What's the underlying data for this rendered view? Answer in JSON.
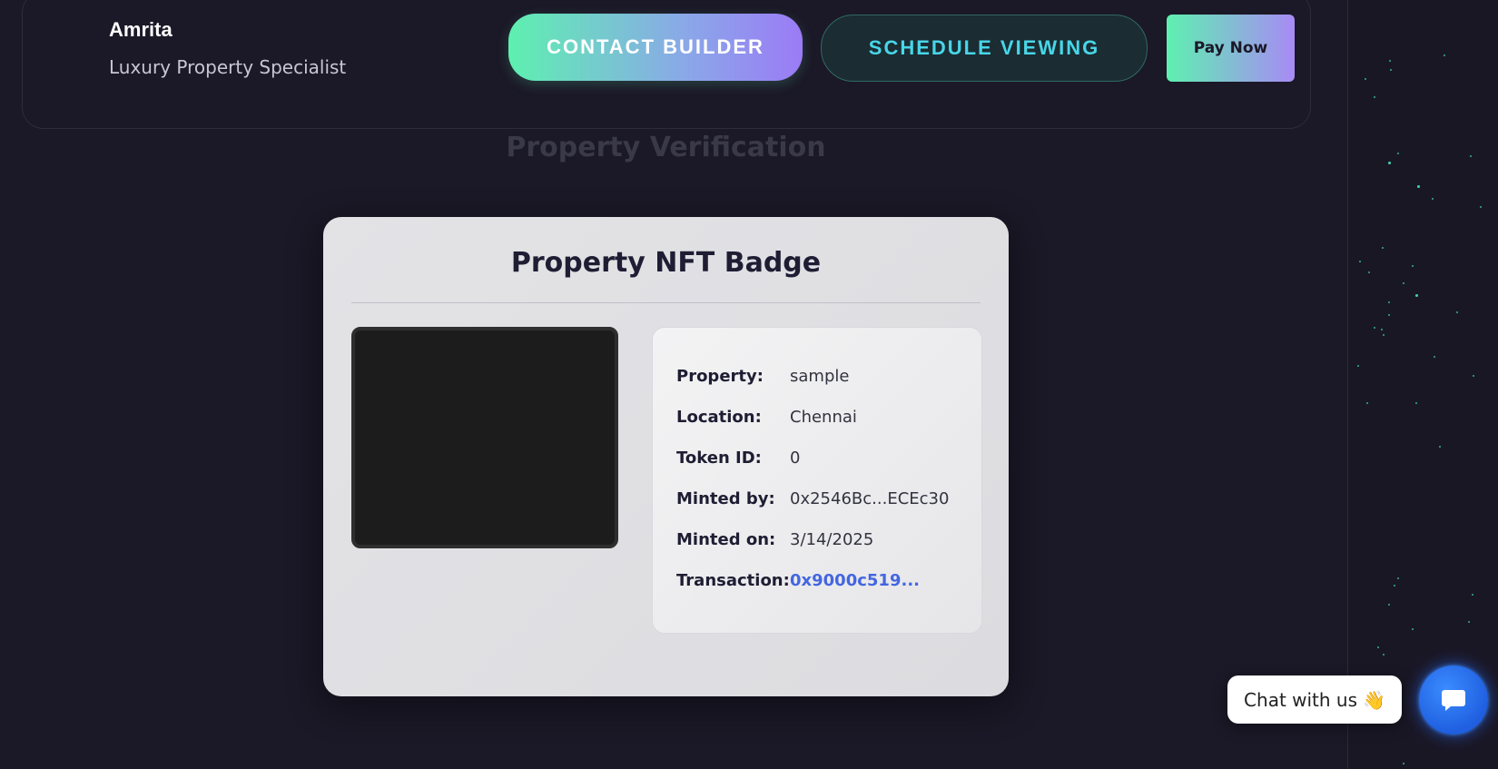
{
  "agent": {
    "name": "Amrita",
    "title": "Luxury Property Specialist"
  },
  "actions": {
    "contact_label": "CONTACT BUILDER",
    "schedule_label": "SCHEDULE VIEWING",
    "pay_label": "Pay Now"
  },
  "section": {
    "title": "Property Verification"
  },
  "nft": {
    "title": "Property NFT Badge",
    "details": [
      {
        "label": "Property:",
        "value": "sample"
      },
      {
        "label": "Location:",
        "value": "Chennai"
      },
      {
        "label": "Token ID:",
        "value": "0"
      },
      {
        "label": "Minted by:",
        "value": "0x2546Bc...ECEc30"
      },
      {
        "label": "Minted on:",
        "value": "3/14/2025"
      },
      {
        "label": "Transaction:",
        "value": "0x9000c519..."
      }
    ]
  },
  "chat": {
    "label": "Chat with us",
    "emoji": "👋",
    "button_icon": "chat-bubble-icon"
  },
  "colors": {
    "background": "#1b1827",
    "accent_green": "#5ef0b0",
    "accent_purple": "#9b7bf6",
    "accent_cyan": "#48d6e8",
    "link_blue": "#4466e0",
    "chat_blue": "#1f5fe0"
  }
}
